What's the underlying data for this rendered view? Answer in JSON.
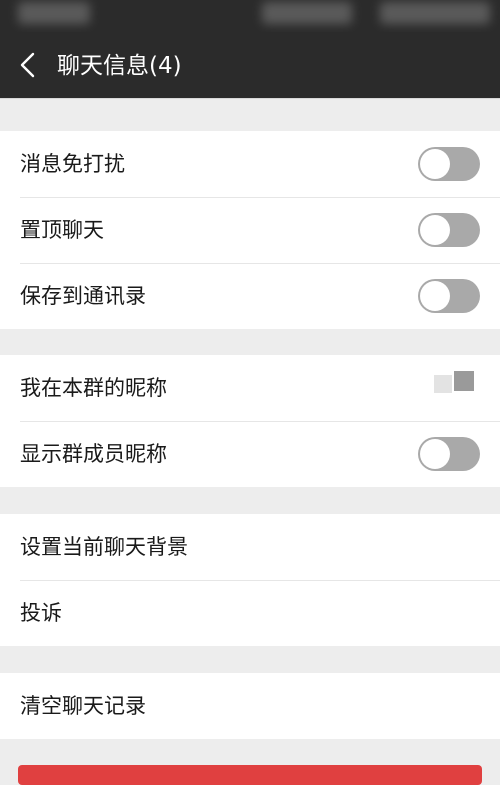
{
  "header": {
    "title": "聊天信息(4)",
    "back_icon": "chevron-left-icon"
  },
  "sections": [
    {
      "rows": [
        {
          "label": "消息免打扰",
          "control": "toggle",
          "on": false
        },
        {
          "label": "置顶聊天",
          "control": "toggle",
          "on": false
        },
        {
          "label": "保存到通讯录",
          "control": "toggle",
          "on": false
        }
      ]
    },
    {
      "rows": [
        {
          "label": "我在本群的昵称",
          "control": "value-blurred"
        },
        {
          "label": "显示群成员昵称",
          "control": "toggle",
          "on": false
        }
      ]
    },
    {
      "rows": [
        {
          "label": "设置当前聊天背景"
        },
        {
          "label": "投诉"
        }
      ]
    },
    {
      "rows": [
        {
          "label": "清空聊天记录"
        }
      ]
    }
  ],
  "colors": {
    "header_bg": "#2b2b2b",
    "page_bg": "#ededed",
    "toggle_off": "#a9a9a9",
    "danger": "#e04040"
  }
}
